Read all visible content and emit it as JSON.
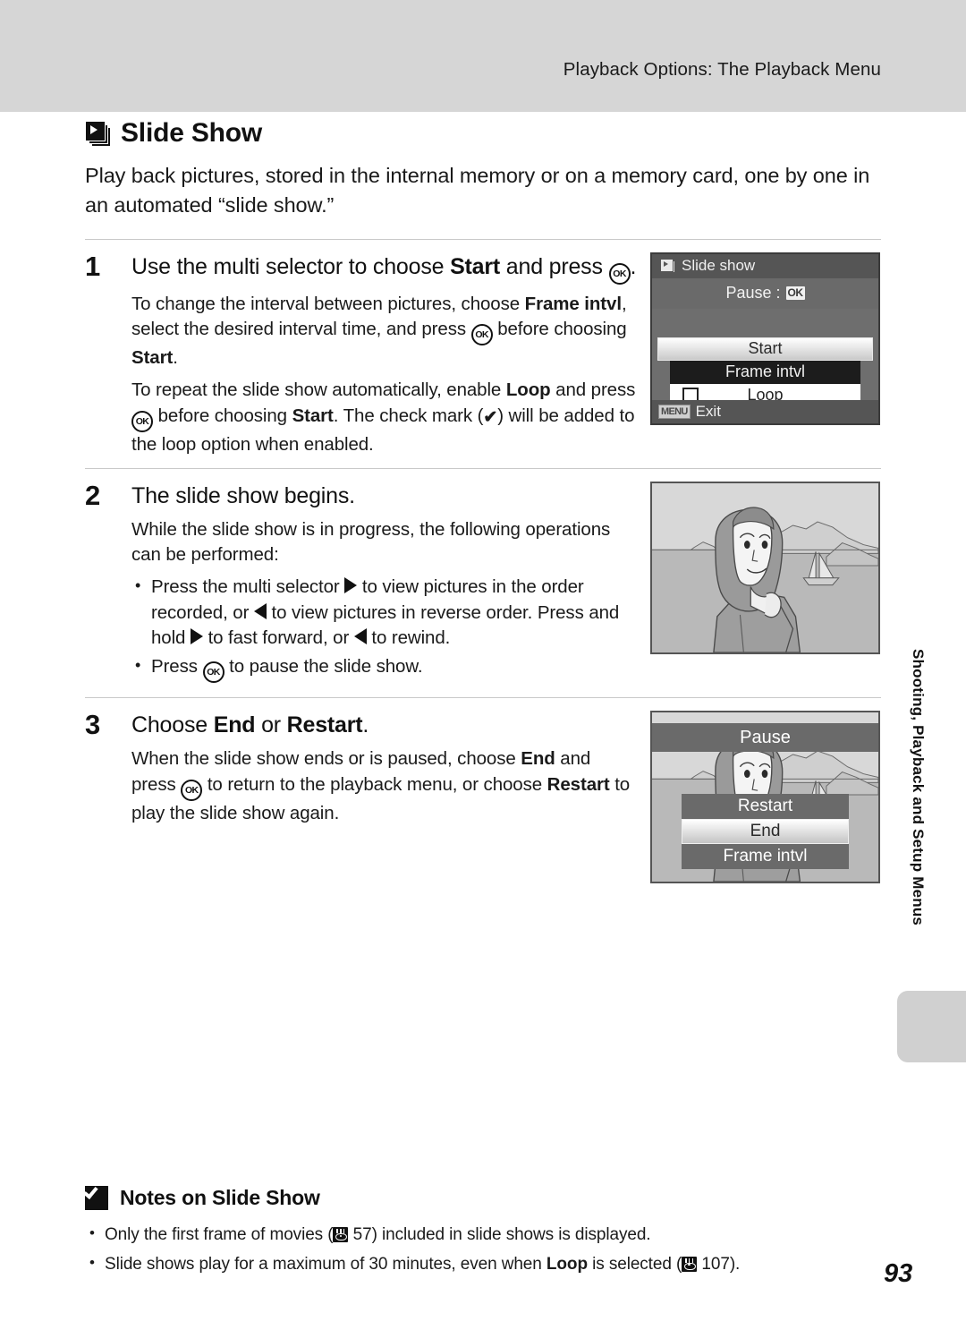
{
  "header": {
    "title": "Playback Options: The Playback Menu"
  },
  "section": {
    "icon": "slideshow-icon",
    "title": "Slide Show",
    "intro": "Play back pictures, stored in the internal memory or on a memory card, one by one in an automated “slide show.”"
  },
  "steps": [
    {
      "number": "1",
      "title_a": "Use the multi selector to choose ",
      "title_b": "Start",
      "title_c": " and press ",
      "title_d": ".",
      "paragraphs": [
        {
          "p1": "To change the interval between pictures, choose ",
          "b1": "Frame intvl",
          "p2": ", select the desired interval time, and press ",
          "p3": " before choosing ",
          "b2": "Start",
          "p4": "."
        },
        {
          "p1": "To repeat the slide show automatically, enable ",
          "b1": "Loop",
          "p2": " and press ",
          "p3": " before choosing ",
          "b2": "Start",
          "p4": ". The check mark (",
          "p5": ") will be added to the loop option when enabled."
        }
      ]
    },
    {
      "number": "2",
      "title": "The slide show begins.",
      "lead": "While the slide show is in progress, the following operations can be performed:",
      "bullets": [
        {
          "a": "Press the multi selector ",
          "b": " to view pictures in the order recorded, or ",
          "c": " to view pictures in reverse order. Press and hold ",
          "d": " to fast forward, or ",
          "e": " to rewind."
        },
        {
          "a": "Press ",
          "b": " to pause the slide show."
        }
      ]
    },
    {
      "number": "3",
      "title_a": "Choose ",
      "title_b": "End",
      "title_c": " or ",
      "title_d": "Restart",
      "title_e": ".",
      "paragraph": {
        "p1": "When the slide show ends or is paused, choose ",
        "b1": "End",
        "p2": " and press ",
        "p3": " to return to the playback menu, or choose ",
        "b2": "Restart",
        "p4": " to play the slide show again."
      }
    }
  ],
  "lcd_menu": {
    "title": "Slide show",
    "pause_label": "Pause :",
    "pause_badge": "OK",
    "rows": [
      {
        "label": "Start",
        "state": "selected",
        "checkbox": false
      },
      {
        "label": "Frame intvl",
        "state": "dark",
        "checkbox": false
      },
      {
        "label": "Loop",
        "state": "white",
        "checkbox": true
      }
    ],
    "exit_badge": "MENU",
    "exit_label": "Exit"
  },
  "lcd_pause": {
    "title": "Pause",
    "rows": [
      {
        "label": "Restart",
        "state": "dark"
      },
      {
        "label": "End",
        "state": "selected"
      },
      {
        "label": "Frame intvl",
        "state": "dark"
      }
    ]
  },
  "side_tab": {
    "label": "Shooting, Playback and Setup Menus"
  },
  "notes": {
    "icon": "caution-check-icon",
    "heading": "Notes on Slide Show",
    "items": [
      {
        "a": "Only the first frame of movies (",
        "ref": "57",
        "b": ") included in slide shows is displayed."
      },
      {
        "a": "Slide shows play for a maximum of 30 minutes, even when ",
        "bold": "Loop",
        "b": " is selected (",
        "ref": "107",
        "c": ")."
      }
    ]
  },
  "page_number": "93",
  "colors": {
    "header_band": "#d6d6d6",
    "tab_block": "#d0d0d0",
    "rule": "#c9c9c9",
    "lcd_bg": "#6e6e6e"
  }
}
